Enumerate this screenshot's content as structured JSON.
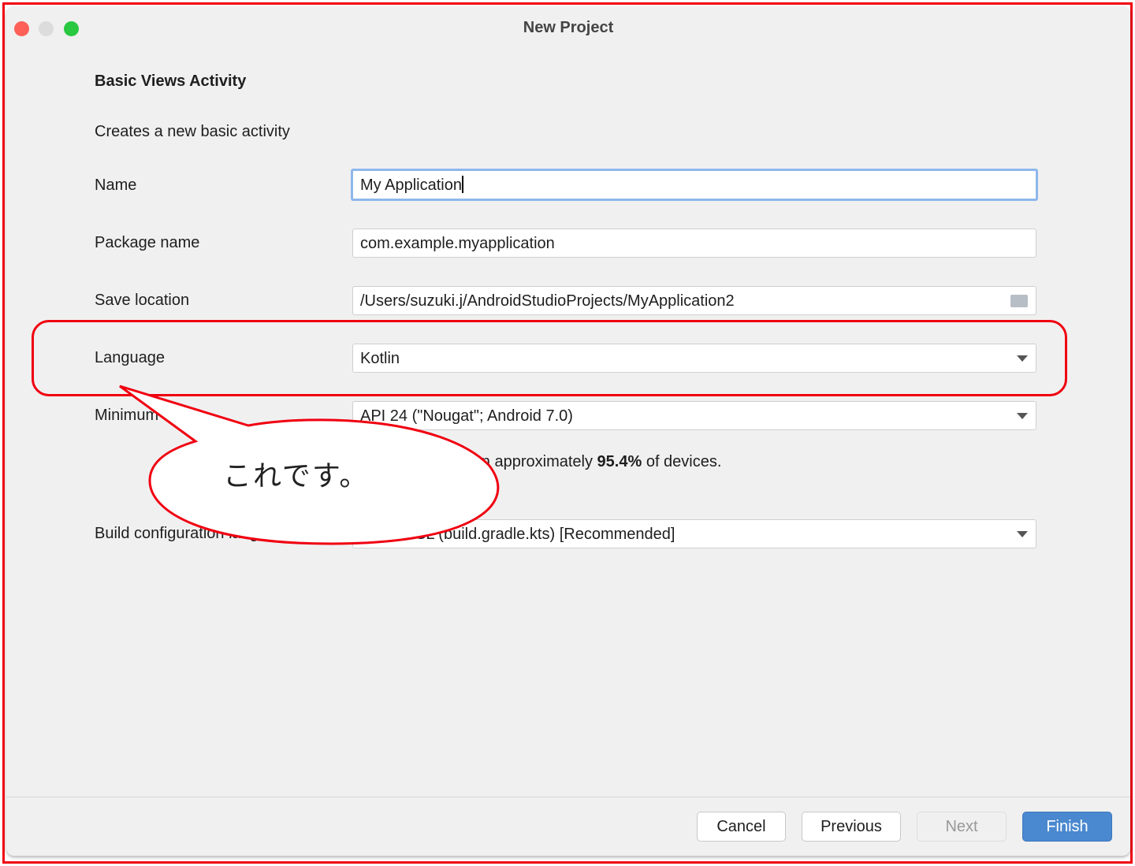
{
  "window": {
    "title": "New Project",
    "colors": {
      "close": "#fe5f57",
      "minimize": "#dcdcdc",
      "zoom": "#28c840"
    }
  },
  "header": {
    "title": "Basic Views Activity",
    "description": "Creates a new basic activity"
  },
  "form": {
    "name": {
      "label": "Name",
      "value": "My Application"
    },
    "package": {
      "label": "Package name",
      "value": "com.example.myapplication"
    },
    "save_location": {
      "label": "Save location",
      "value": "/Users/suzuki.j/AndroidStudioProjects/MyApplication2"
    },
    "language": {
      "label": "Language",
      "value": "Kotlin"
    },
    "min_sdk": {
      "label": "Minimum SDK",
      "value": "API 24 (\"Nougat\"; Android 7.0)"
    },
    "sdk_note": {
      "prefix": "Your app will run on approximately ",
      "percent": "95.4%",
      "suffix": " of devices."
    },
    "build_config": {
      "label": "Build configuration language",
      "value": "Kotlin DSL (build.gradle.kts) [Recommended]"
    }
  },
  "buttons": {
    "cancel": "Cancel",
    "previous": "Previous",
    "next": "Next",
    "finish": "Finish"
  },
  "annotation": {
    "text": "これです。",
    "color": "#f00010"
  }
}
